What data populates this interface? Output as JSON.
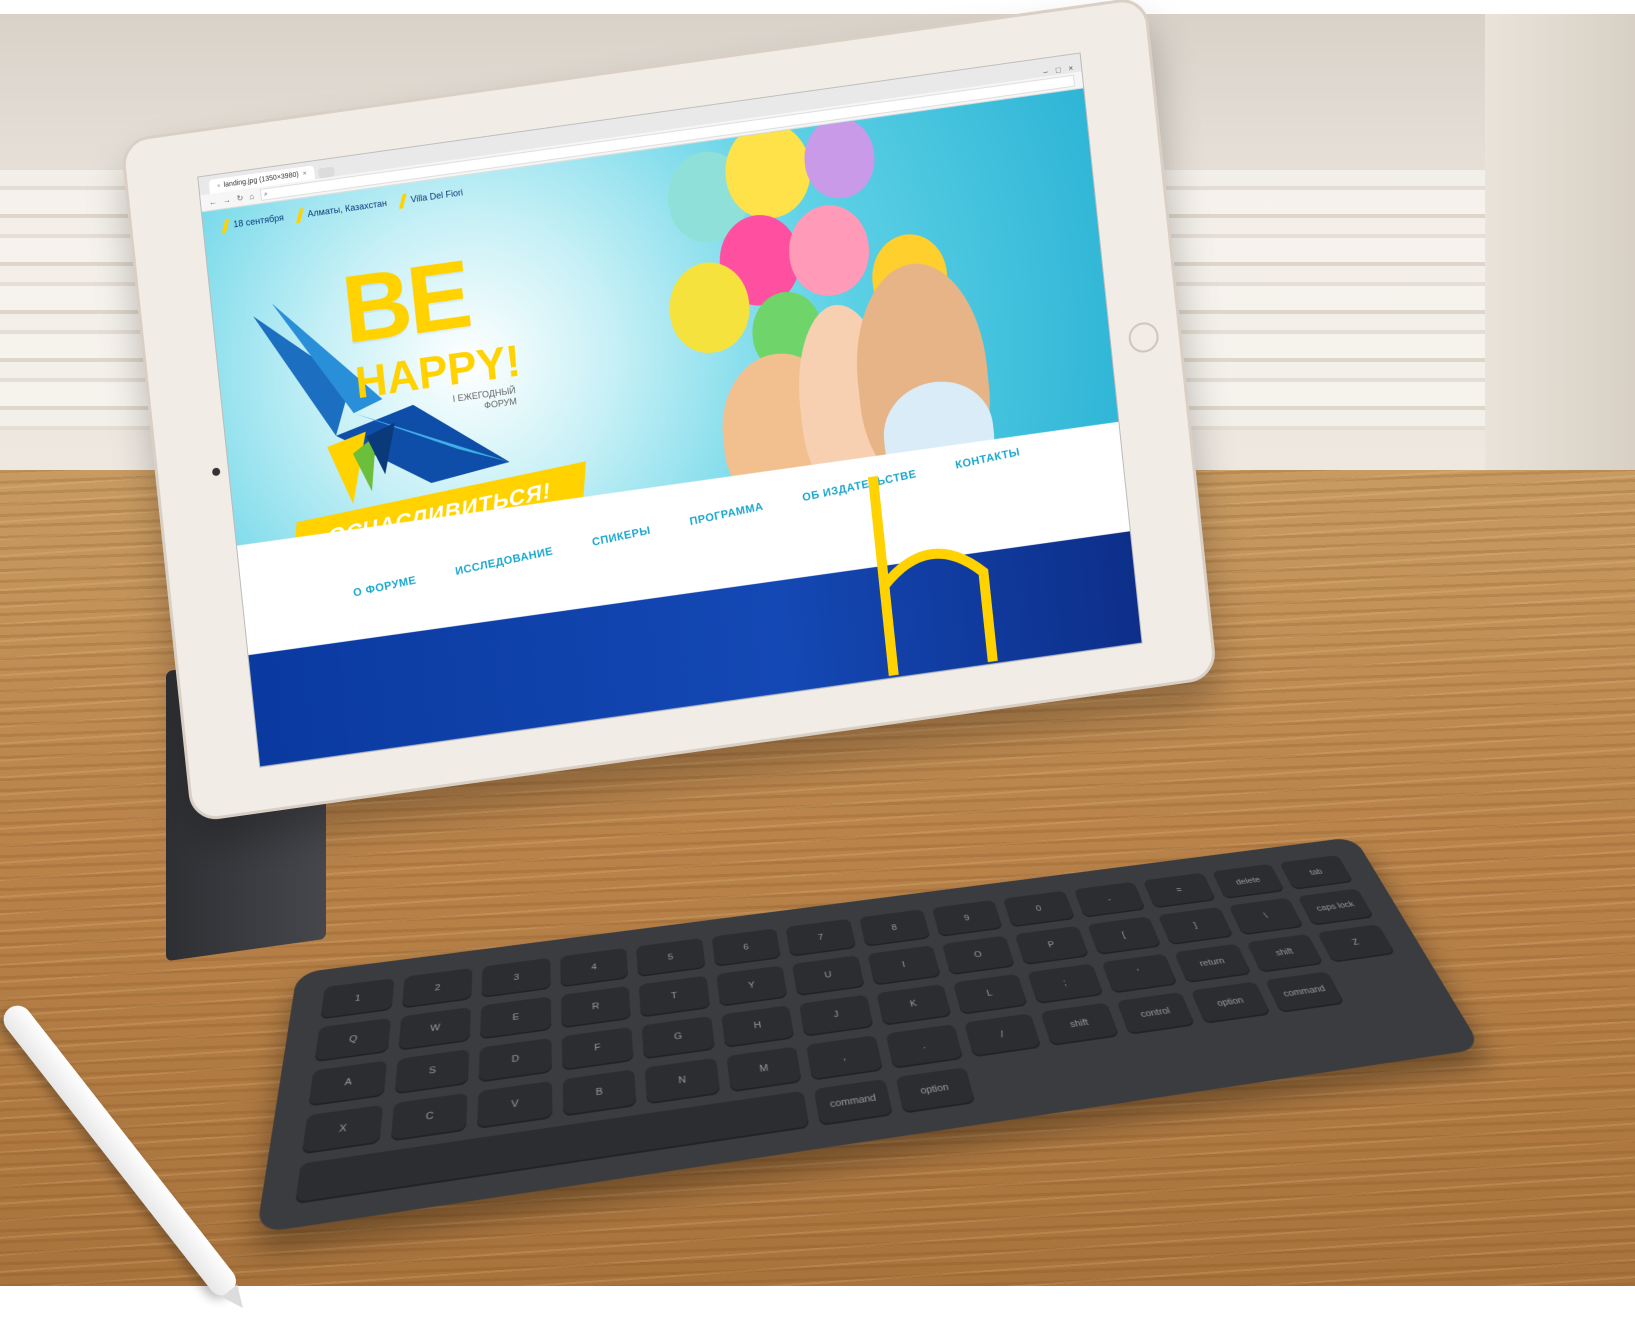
{
  "browser": {
    "tab_title": "landing.jpg (1350×3980)",
    "tab_close": "×"
  },
  "site": {
    "top_info": [
      "18 сентября",
      "Алматы, Казахстан",
      "Villa Del Fiori"
    ],
    "title_be": "BE",
    "title_happy": "HAPPY!",
    "subtitle_line1": "I ЕЖЕГОДНЫЙ",
    "subtitle_line2": "ФОРУМ",
    "cta_label": "ОСЧАСЛИВИТЬСЯ!",
    "nav": [
      "О ФОРУМЕ",
      "ИССЛЕДОВАНИЕ",
      "СПИКЕРЫ",
      "ПРОГРАММА",
      "ОБ ИЗДАТЕЛЬСТВЕ",
      "КОНТАКТЫ"
    ]
  },
  "keyboard": {
    "keys": [
      "1",
      "2",
      "3",
      "4",
      "5",
      "6",
      "7",
      "8",
      "9",
      "0",
      "-",
      "=",
      "delete",
      "tab",
      "Q",
      "W",
      "E",
      "R",
      "T",
      "Y",
      "U",
      "I",
      "O",
      "P",
      "[",
      "]",
      "\\",
      "caps lock",
      "A",
      "S",
      "D",
      "F",
      "G",
      "H",
      "J",
      "K",
      "L",
      ";",
      "'",
      "return",
      "shift",
      "Z",
      "X",
      "C",
      "V",
      "B",
      "N",
      "M",
      ",",
      ".",
      "/",
      "shift",
      "control",
      "option",
      "command",
      "",
      "command",
      "option"
    ]
  },
  "colors": {
    "accent_yellow": "#ffd200",
    "brand_blue": "#0a3aa0",
    "nav_cyan": "#1aa7cf"
  }
}
